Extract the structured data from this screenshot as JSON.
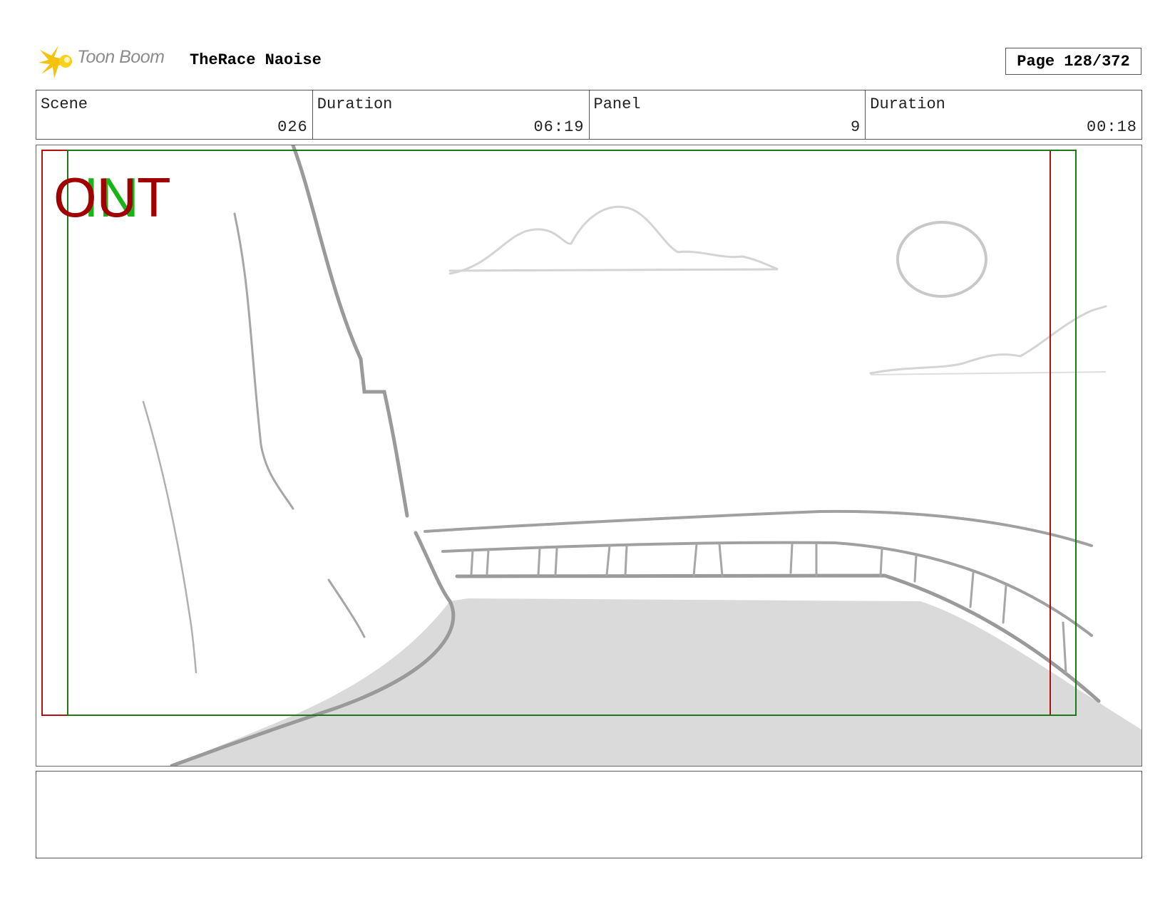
{
  "header": {
    "logo_text": "Toon Boom",
    "project_title": "TheRace Naoise",
    "page_label": "Page 128/372"
  },
  "info": {
    "scene_label": "Scene",
    "scene_value": "026",
    "scene_duration_label": "Duration",
    "scene_duration_value": "06:19",
    "panel_label": "Panel",
    "panel_value": "9",
    "panel_duration_label": "Duration",
    "panel_duration_value": "00:18"
  },
  "panel": {
    "in_marker": "IN",
    "out_marker": "OUT"
  },
  "notes": {
    "text": ""
  },
  "colors": {
    "in_frame": "#1a7a1a",
    "out_frame": "#b01010",
    "sketch_line": "#9a9a9a",
    "ground_fill": "#dadada"
  }
}
